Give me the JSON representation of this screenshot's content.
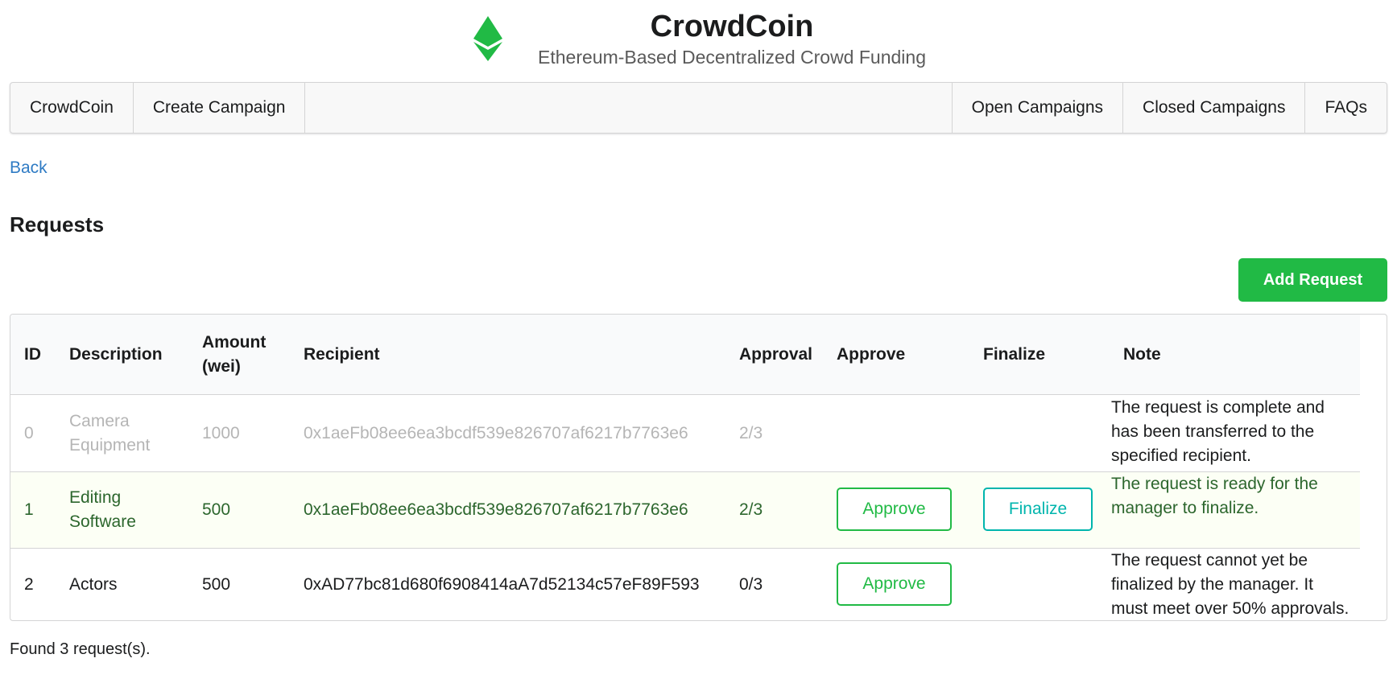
{
  "header": {
    "title": "CrowdCoin",
    "subtitle": "Ethereum-Based Decentralized Crowd Funding",
    "logo_icon": "ethereum-logo-icon",
    "logo_color": "#21ba45"
  },
  "nav": {
    "left": [
      "CrowdCoin",
      "Create Campaign"
    ],
    "right": [
      "Open Campaigns",
      "Closed Campaigns",
      "FAQs"
    ]
  },
  "back_label": "Back",
  "page_title": "Requests",
  "add_request_label": "Add Request",
  "table": {
    "headers": {
      "id": "ID",
      "description": "Description",
      "amount": "Amount (wei)",
      "recipient": "Recipient",
      "approval": "Approval",
      "approve": "Approve",
      "finalize": "Finalize",
      "note": "Note"
    },
    "rows": [
      {
        "id": "0",
        "description": "Camera Equipment",
        "amount": "1000",
        "recipient": "0x1aeFb08ee6ea3bcdf539e826707af6217b7763e6",
        "approval": "2/3",
        "approve_label": "",
        "finalize_label": "",
        "note": "The request is complete and has been transferred to the specified recipient.",
        "status": "complete"
      },
      {
        "id": "1",
        "description": "Editing Software",
        "amount": "500",
        "recipient": "0x1aeFb08ee6ea3bcdf539e826707af6217b7763e6",
        "approval": "2/3",
        "approve_label": "Approve",
        "finalize_label": "Finalize",
        "note": "The request is ready for the manager to finalize.",
        "status": "ready"
      },
      {
        "id": "2",
        "description": "Actors",
        "amount": "500",
        "recipient": "0xAD77bc81d680f6908414aA7d52134c57eF89F593",
        "approval": "0/3",
        "approve_label": "Approve",
        "finalize_label": "",
        "note": "The request cannot yet be finalized by the manager. It must meet over 50% approvals.",
        "status": "pending"
      }
    ]
  },
  "footer_count": "Found 3 request(s).",
  "colors": {
    "accent_green": "#21ba45",
    "teal": "#00b5ad",
    "link_blue": "#2f7bc4",
    "positive_row": "#fcfff5",
    "positive_text": "#2c662d",
    "disabled_text": "#b5b5b5"
  }
}
